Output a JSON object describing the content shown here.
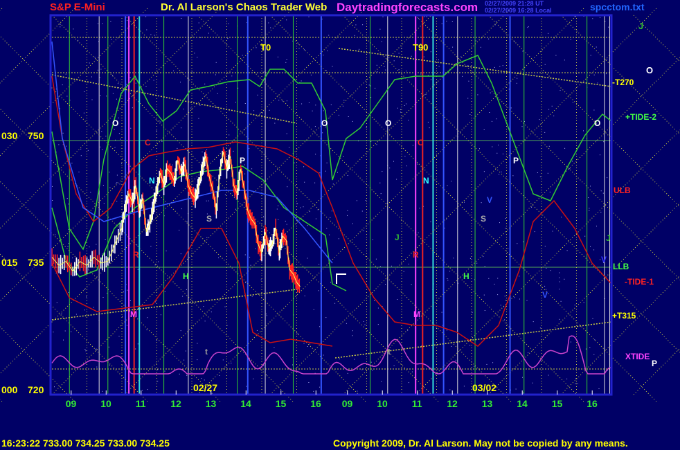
{
  "header": {
    "instrument": "S&P E-Mini",
    "title": "Dr. Al Larson's Chaos Trader Web",
    "site": "Daytradingforecasts.com",
    "stamp1": "02/27/2009 21:28 UT",
    "stamp2": "02/27/2009 16:28 Local",
    "file": "spcctom.txt"
  },
  "footer": {
    "quote": "16:23:22  733.00 734.25 733.00 734.25",
    "copyright": "Copyright 2009, Dr. Al Larson. May not be copied by any means."
  },
  "right_labels": [
    "J",
    "O",
    "-T270",
    "+TIDE-2",
    "ULB",
    "J",
    "LLB",
    "V",
    "-TIDE-1",
    "+T315",
    "XTIDE",
    "P"
  ],
  "top_labels": [
    "T0",
    "T90"
  ],
  "date_labels": [
    "02/27",
    "03/02"
  ],
  "colors": {
    "background": "#000066",
    "plot_border": "#2222cc",
    "price_up": "#ffffff",
    "price_down": "#ff2222",
    "tide_green": "#33cc33",
    "xtide_magenta": "#cc44cc",
    "band_red": "#cc1111",
    "grid_yellow": "#cccc44",
    "label_yellow": "#ffff00"
  },
  "chart_data": {
    "type": "line",
    "title": "",
    "ylim": [
      720,
      755
    ],
    "y_ticks": [
      {
        "left": "030",
        "right": "750",
        "value": 750
      },
      {
        "left": "015",
        "right": "735",
        "value": 735
      },
      {
        "left": "000",
        "right": "720",
        "value": 720
      }
    ],
    "x_ticks": [
      "09",
      "10",
      "11",
      "12",
      "13",
      "14",
      "15",
      "16",
      "09",
      "10",
      "11",
      "12",
      "13",
      "14",
      "15",
      "16"
    ],
    "hours_per_day": 8,
    "series": [
      {
        "x": [
          0,
          0.2,
          0.4,
          0.6,
          0.8,
          1.0,
          1.2,
          1.4,
          1.6,
          1.8,
          2.0,
          2.1,
          2.2,
          2.3,
          2.4,
          2.5,
          2.6,
          2.7,
          2.8,
          2.9,
          3.0,
          3.1,
          3.2,
          3.3,
          3.4,
          3.5,
          3.6,
          3.7,
          3.8,
          3.9,
          4.0,
          4.1,
          4.2,
          4.3,
          4.4,
          4.5,
          4.6,
          4.7,
          4.8,
          4.9,
          5.0,
          5.1,
          5.2,
          5.3,
          5.4,
          5.5,
          5.6,
          5.7,
          5.8,
          5.9,
          6.0,
          6.1,
          6.2,
          6.3,
          6.4,
          6.5,
          6.6,
          6.7,
          6.8,
          6.9,
          7.0,
          7.1
        ],
        "y": [
          735.5,
          734.5,
          735.0,
          733.8,
          735.0,
          734.5,
          735.5,
          734.8,
          735.0,
          737.0,
          739.0,
          741.5,
          743.0,
          742.0,
          744.0,
          741.0,
          742.5,
          738.5,
          739.5,
          741.5,
          743.5,
          745.5,
          744.0,
          746.0,
          745.5,
          744.5,
          747.0,
          745.5,
          746.5,
          744.0,
          743.0,
          742.5,
          744.0,
          746.0,
          747.5,
          745.0,
          743.5,
          741.0,
          745.5,
          748.0,
          746.0,
          747.5,
          744.0,
          743.0,
          746.0,
          743.5,
          741.0,
          740.0,
          739.5,
          737.0,
          736.0,
          738.5,
          736.5,
          737.0,
          739.0,
          736.0,
          738.0,
          737.5,
          734.0,
          733.5,
          732.5,
          732.0
        ]
      }
    ]
  }
}
